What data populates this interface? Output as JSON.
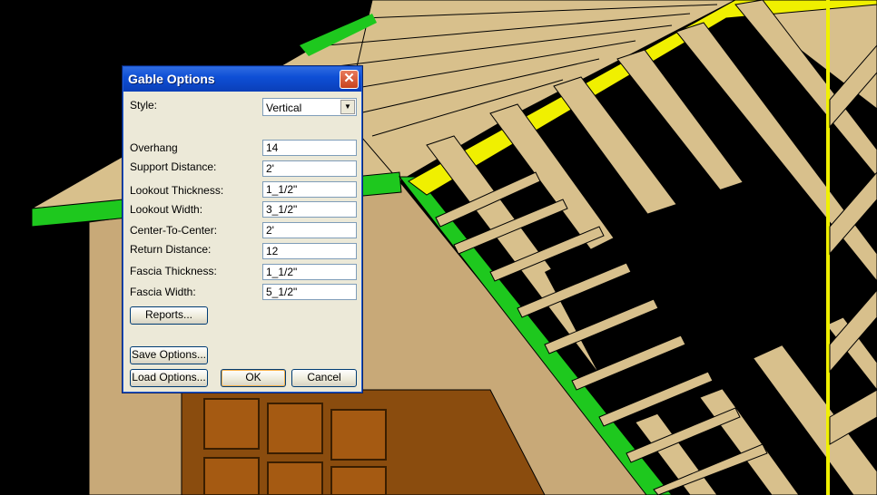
{
  "dialog": {
    "title": "Gable Options",
    "style_label": "Style:",
    "style_value": "Vertical",
    "fields": [
      {
        "label": "Overhang",
        "value": "14"
      },
      {
        "label": "Support Distance:",
        "value": "2'"
      },
      {
        "label": "Lookout Thickness:",
        "value": "1_1/2\""
      },
      {
        "label": "Lookout Width:",
        "value": "3_1/2\""
      },
      {
        "label": "Center-To-Center:",
        "value": "2'"
      },
      {
        "label": "Return Distance:",
        "value": "12"
      },
      {
        "label": "Fascia Thickness:",
        "value": "1_1/2\""
      },
      {
        "label": "Fascia Width:",
        "value": "5_1/2\""
      }
    ],
    "buttons": {
      "reports": "Reports...",
      "save": "Save Options...",
      "load": "Load Options...",
      "ok": "OK",
      "cancel": "Cancel"
    }
  }
}
